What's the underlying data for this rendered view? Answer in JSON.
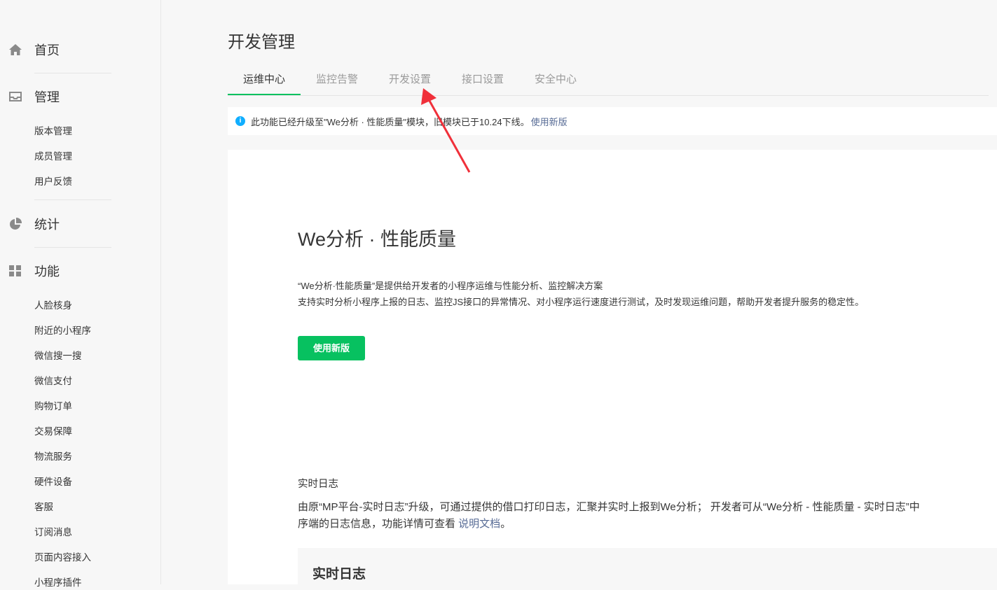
{
  "sidebar": {
    "sections": [
      {
        "label": "首页",
        "icon": "home-icon"
      },
      {
        "label": "管理",
        "icon": "inbox-icon"
      },
      {
        "label": "统计",
        "icon": "pie-chart-icon"
      },
      {
        "label": "功能",
        "icon": "grid-icon"
      }
    ],
    "manage_items": [
      "版本管理",
      "成员管理",
      "用户反馈"
    ],
    "feature_items": [
      "人脸核身",
      "附近的小程序",
      "微信搜一搜",
      "微信支付",
      "购物订单",
      "交易保障",
      "物流服务",
      "硬件设备",
      "客服",
      "订阅消息",
      "页面内容接入",
      "小程序插件"
    ]
  },
  "main": {
    "title": "开发管理",
    "tabs": [
      {
        "label": "运维中心",
        "active": true
      },
      {
        "label": "监控告警",
        "active": false
      },
      {
        "label": "开发设置",
        "active": false
      },
      {
        "label": "接口设置",
        "active": false
      },
      {
        "label": "安全中心",
        "active": false
      }
    ],
    "notice": {
      "text": "此功能已经升级至\"We分析 · 性能质量\"模块，旧模块已于10.24下线。",
      "link": "使用新版"
    },
    "card": {
      "title": "We分析 · 性能质量",
      "desc_line1": "“We分析·性能质量”是提供给开发者的小程序运维与性能分析、监控解决方案",
      "desc_line2": "支持实时分析小程序上报的日志、监控JS接口的异常情况、对小程序运行速度进行测试，及时发现运维问题，帮助开发者提升服务的稳定性。",
      "button": "使用新版",
      "section_title": "实时日志",
      "para_line1": "由原“MP平台-实时日志”升级，可通过提供的借口打印日志，汇聚并实时上报到We分析； 开发者可从“We分析 - 性能质量 - 实时日志”中",
      "para_line2": "序端的日志信息，功能详情可查看 ",
      "para_link": "说明文档",
      "para_end": "。",
      "box_title": "实时日志"
    }
  },
  "colors": {
    "accent": "#07c160",
    "link": "#576b95",
    "info": "#10aeff",
    "annotation_arrow": "#f0303a"
  }
}
